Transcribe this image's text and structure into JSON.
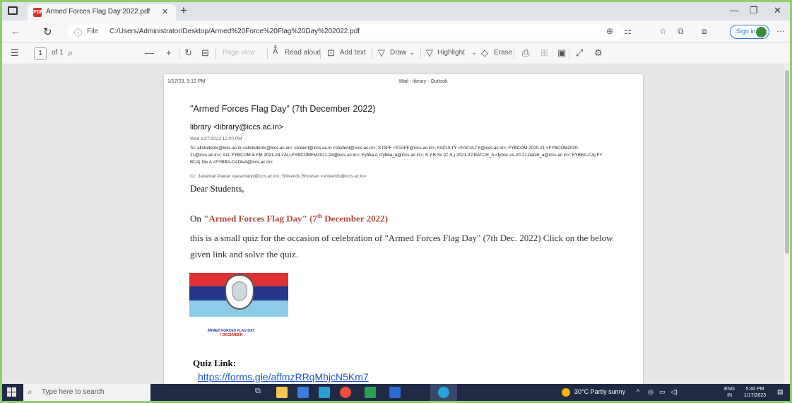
{
  "browser": {
    "tab_title": "Armed Forces Flag Day 2022.pdf",
    "tab_icon": "PDF",
    "url_label": "File",
    "url": "C:/Users/Administrator/Desktop/Armed%20Force%20Flag%20Day%202022.pdf",
    "signin_label": "Sign in"
  },
  "pdf_toolbar": {
    "page_number": "1",
    "page_total": "of 1",
    "page_view": "Page view",
    "read_aloud": "Read aloud",
    "add_text": "Add text",
    "draw": "Draw",
    "highlight": "Highlight",
    "erase": "Erase"
  },
  "page": {
    "header_left": "1/17/23, 5:12 PM",
    "header_center": "Mail - library - Outlook",
    "mail_title": "\"Armed Forces Flag Day\" (7th December 2022)",
    "from": "library <library@iccs.ac.in>",
    "date": "Wed 12/7/2022 12:00 PM",
    "to": "To: allstudents@iccs.ac.in <allstudents@iccs.ac.in>; student@iccs.ac.in <student@iccs.ac.in>; STAFF <STAFF@iccs.ac.in>; FACULTY <FACULTY@iccs.ac.in>; FYBCOM 2020-21 <FYBCOM2020-21@iccs.ac.in>; ALL FYBCOM & FM 2021-24 <ALLFYBCOMFM2021-24@iccs.ac.in>; Fybba A <fybba_a@iccs.ac.in>; S.Y.B.Sc.(C.S.) 2021-22 BATCH_A <fybsc-cs-20-21-batch_a@iccs.ac.in>; FYBBA-CA| FY BCA| Div A <FYBBA-CADivA@iccs.ac.in>",
    "cc": "Cc: Janardan Pawar <janardanp@iccs.ac.in>; Shivendu Bhushan <shivendu@iccs.ac.in>",
    "greeting": "Dear Students,",
    "on_prefix": "On ",
    "on_event": "\"Armed Forces Flag Day\" (7",
    "on_sup": "th",
    "on_suffix": " December 2022)",
    "body": "this is a small quiz for the occasion of celebration of \"Armed Forces Flag Day\"  (7th Dec. 2022) Click on the below given link and solve the quiz.",
    "flag_caption": "ARMED FORCES FLAG DAY",
    "flag_date": "7 DECEMBER",
    "quiz_label": "Quiz Link:",
    "quiz_url": "https://forms.gle/affmzRRqMhjcN5Km7"
  },
  "taskbar": {
    "search_placeholder": "Type here to search",
    "weather": "30°C  Partly sunny",
    "lang_top": "ENG",
    "lang_bottom": "IN",
    "time": "5:40 PM",
    "date": "1/17/2023"
  },
  "colors": {
    "flag_red": "#e03132",
    "flag_blue": "#26368b",
    "flag_sky": "#8dcbe8",
    "event_text": "#b84a45",
    "link": "#1f56c9",
    "taskbar": "#202a44"
  }
}
